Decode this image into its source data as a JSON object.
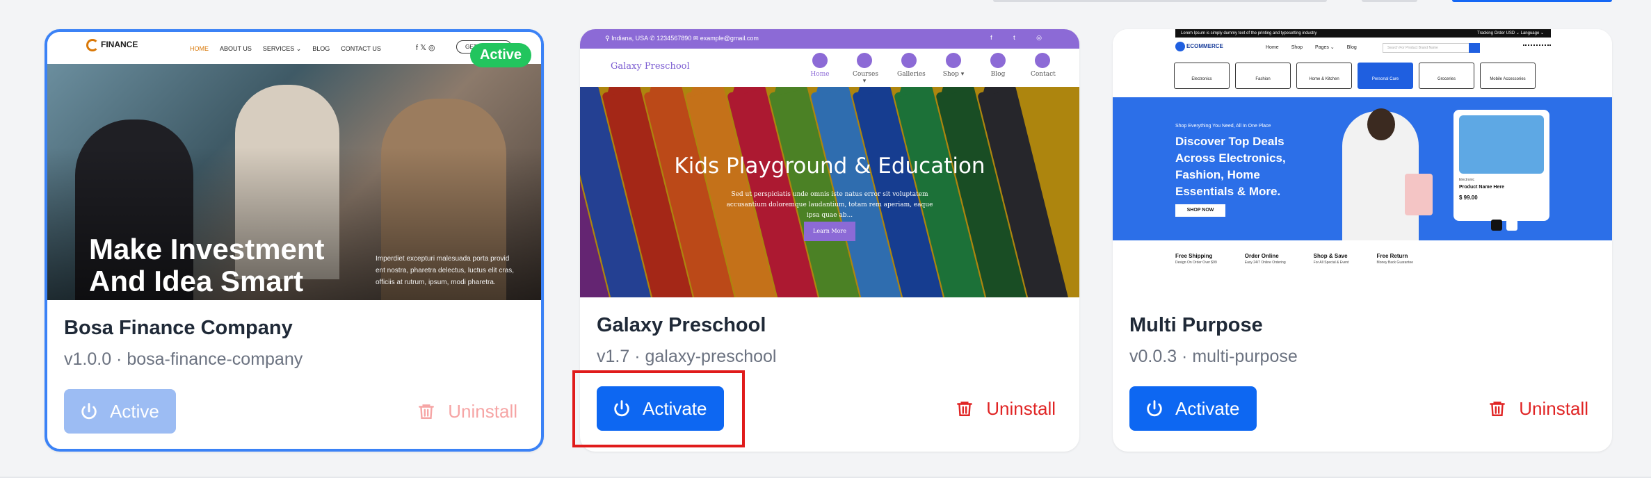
{
  "cards": [
    {
      "name": "Bosa Finance Company",
      "meta": "v1.0.0 · bosa-finance-company",
      "primary_label": "Active",
      "uninstall_label": "Uninstall",
      "badge": "Active",
      "thumb": {
        "logo": "FINANCE",
        "menu": [
          "HOME",
          "ABOUT US",
          "SERVICES ⌄",
          "BLOG",
          "CONTACT US"
        ],
        "social": "f 𝕏 ◎",
        "cta": "GET A QUOTE",
        "headline": "Make Investment And Idea Smart",
        "paragraph": "Imperdiet excepturi malesuada porta provid ent nostra, pharetra delectus, luctus elit cras, officiis at rutrum, ipsum, modi pharetra."
      }
    },
    {
      "name": "Galaxy Preschool",
      "meta": "v1.7 · galaxy-preschool",
      "primary_label": "Activate",
      "uninstall_label": "Uninstall",
      "thumb": {
        "top_info": "⚲ Indiana, USA    ✆ 1234567890    ✉ example@gmail.com",
        "top_social": "f t ◎",
        "brand": "Galaxy Preschool",
        "menu": [
          "Home",
          "Courses ▾",
          "Galleries",
          "Shop ▾",
          "Blog",
          "Contact"
        ],
        "headline": "Kids Playground & Education",
        "paragraph": "Sed ut perspiciatis unde omnis iste natus error sit voluptatem accusantium doloremque laudantium, totam rem aperiam, eaque ipsa quae ab...",
        "button": "Learn More"
      }
    },
    {
      "name": "Multi Purpose",
      "meta": "v0.0.3 · multi-purpose",
      "primary_label": "Activate",
      "uninstall_label": "Uninstall",
      "thumb": {
        "strip": "Lorem Ipsum is simply dummy text of the printing and typesetting industry",
        "strip_right": "Tracking Order    USD ⌄    Language ⌄",
        "logo": "ECOMMERCE",
        "menu": [
          "Home",
          "Shop",
          "Pages ⌄",
          "Blog"
        ],
        "search": "Search For Product Brand Name",
        "categories": [
          "Electronics",
          "Fashion",
          "Home & Kitchen",
          "Personal Care",
          "Groceries",
          "Mobile Accessories"
        ],
        "hero_sub": "Shop Everything You Need, All In One Place",
        "hero_headline": "Discover Top Deals Across Electronics, Fashion, Home Essentials & More.",
        "shop_now": "SHOP NOW",
        "product_cat": "Electronic",
        "product_name": "Product Name Here",
        "product_price": "$ 99.00",
        "features": [
          {
            "title": "Free Shipping",
            "sub": "Design On Order Over $99"
          },
          {
            "title": "Order Online",
            "sub": "Easy 24/7 Online Ordering"
          },
          {
            "title": "Shop & Save",
            "sub": "For All Special & Event"
          },
          {
            "title": "Free Return",
            "sub": "Money Back Guarantee"
          }
        ]
      }
    }
  ],
  "colors": {
    "activate": "#0d67f2",
    "active_disabled": "#9cbcf3",
    "uninstall": "#e02424",
    "active_badge": "#22c55e",
    "active_border": "#3b82f6",
    "highlight": "#e01b1b"
  },
  "icons": {
    "power": "power-icon",
    "trash": "trash-icon"
  }
}
